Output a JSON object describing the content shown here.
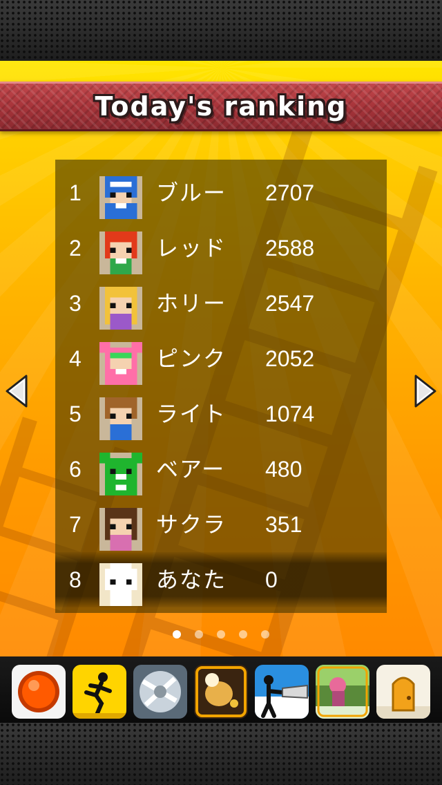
{
  "title": "Today's ranking",
  "ranking": [
    {
      "rank": "1",
      "name": "ブルー",
      "score": "2707",
      "avatar": "blue-hero-avatar"
    },
    {
      "rank": "2",
      "name": "レッド",
      "score": "2588",
      "avatar": "red-hair-avatar"
    },
    {
      "rank": "3",
      "name": "ホリー",
      "score": "2547",
      "avatar": "blonde-girl-avatar"
    },
    {
      "rank": "4",
      "name": "ピンク",
      "score": "2052",
      "avatar": "pink-hero-avatar"
    },
    {
      "rank": "5",
      "name": "ライト",
      "score": "1074",
      "avatar": "brown-hair-boy-avatar"
    },
    {
      "rank": "6",
      "name": "ベアー",
      "score": "480",
      "avatar": "green-bear-avatar"
    },
    {
      "rank": "7",
      "name": "サクラ",
      "score": "351",
      "avatar": "brown-hair-girl-avatar"
    },
    {
      "rank": "8",
      "name": "あなた",
      "score": "0",
      "avatar": "white-blank-avatar"
    }
  ],
  "highlighted_rank": "8",
  "pager": {
    "pages": 5,
    "current": 1
  },
  "nav": {
    "prev": "chevron-left-icon",
    "next": "chevron-right-icon"
  },
  "apps": [
    "orange-ball-app-icon",
    "stickman-runner-app-icon",
    "silver-blades-app-icon",
    "golden-pot-app-icon",
    "stickman-saw-app-icon",
    "forest-girl-app-icon",
    "door-app-icon"
  ],
  "colors": {
    "title_bar": "#a7343a",
    "background_top": "#ffe600",
    "background_bottom": "#ff8a00",
    "panel": "#463700"
  }
}
